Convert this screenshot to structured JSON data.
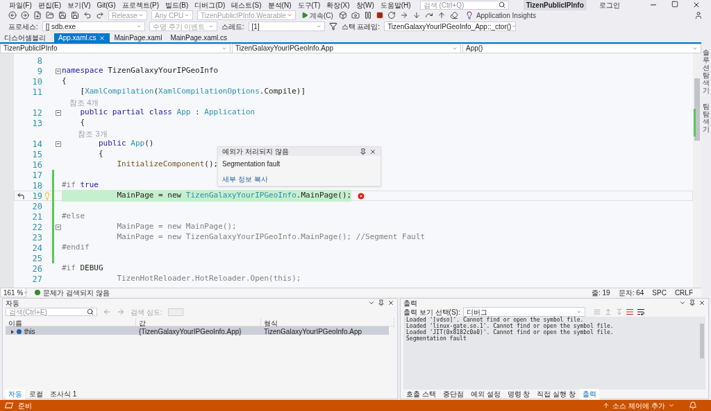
{
  "menu": {
    "items": [
      "파일(F)",
      "편집(E)",
      "보기(V)",
      "Git(G)",
      "프로젝트(P)",
      "빌드(B)",
      "디버그(D)",
      "테스트(S)",
      "분석(N)",
      "도구(T)",
      "확장(X)",
      "창(W)",
      "도움말(H)"
    ],
    "search_placeholder": "검색 (Ctrl+Q)",
    "solution_name": "TizenPublicIPInfo",
    "sign_in": "로그인"
  },
  "toolbar": {
    "configuration": "Release",
    "platform": "Any CPU",
    "startup": "TizenPublicIPInfo.Wearable",
    "continue": "계속(C)",
    "insights": "Application Insights"
  },
  "debug_bar": {
    "process_label": "프로세스:",
    "process": "[] sdb.exe",
    "lifecycle": "수명 주기 이벤트",
    "thread_label": "스레드:",
    "thread": "[1]",
    "stack_label": "스택 프레임:",
    "stack_frame": "TizenGalaxyYourIPGeoInfo_App::_ctor()"
  },
  "doc_tabs": [
    {
      "label": "디스어셈블리",
      "selected": false
    },
    {
      "label": "App.xaml.cs",
      "selected": true
    },
    {
      "label": "MainPage.xaml",
      "selected": false
    },
    {
      "label": "MainPage.xaml.cs",
      "selected": false
    }
  ],
  "nav_bar": {
    "project": "TizenPublicIPInfo",
    "type": "TizenGalaxyYourIPGeoInfo.App",
    "member": "App()"
  },
  "code_lines": [
    {
      "kind": "code",
      "number": "8",
      "fold": false,
      "changed": false,
      "current": false
    },
    {
      "kind": "code",
      "number": "9",
      "fold": true,
      "changed": false,
      "current": false,
      "tokens": [
        {
          "kind": "keyword",
          "text": "namespace"
        },
        {
          "kind": "plain",
          "text": " TizenGalaxyYourIPGeoInfo"
        }
      ]
    },
    {
      "kind": "code",
      "number": "10",
      "fold": false,
      "changed": false,
      "current": false,
      "tokens": [
        {
          "kind": "plain",
          "text": "{"
        }
      ]
    },
    {
      "kind": "code",
      "number": "11",
      "fold": false,
      "changed": false,
      "current": false,
      "tokens": [
        {
          "kind": "plain",
          "text": "    ["
        },
        {
          "kind": "type",
          "text": "XamlCompilation"
        },
        {
          "kind": "plain",
          "text": "("
        },
        {
          "kind": "type",
          "text": "XamlCompilationOptions"
        },
        {
          "kind": "plain",
          "text": ".Compile)]"
        }
      ]
    },
    {
      "kind": "lens",
      "text": "    참조 4개"
    },
    {
      "kind": "code",
      "number": "12",
      "fold": true,
      "changed": false,
      "current": false,
      "tokens": [
        {
          "kind": "keyword",
          "text": "    public partial class "
        },
        {
          "kind": "type",
          "text": "App"
        },
        {
          "kind": "plain",
          "text": " : "
        },
        {
          "kind": "type",
          "text": "Application"
        }
      ]
    },
    {
      "kind": "code",
      "number": "13",
      "fold": false,
      "changed": false,
      "current": false,
      "tokens": [
        {
          "kind": "plain",
          "text": "    {"
        }
      ]
    },
    {
      "kind": "lens",
      "text": "        참조 3개"
    },
    {
      "kind": "code",
      "number": "14",
      "fold": true,
      "changed": false,
      "current": false,
      "tokens": [
        {
          "kind": "keyword",
          "text": "        public "
        },
        {
          "kind": "type",
          "text": "App"
        },
        {
          "kind": "plain",
          "text": "()"
        }
      ]
    },
    {
      "kind": "code",
      "number": "15",
      "fold": false,
      "changed": false,
      "current": false,
      "tokens": [
        {
          "kind": "plain",
          "text": "        {"
        }
      ]
    },
    {
      "kind": "code",
      "number": "16",
      "fold": false,
      "changed": false,
      "current": false,
      "tokens": [
        {
          "kind": "method",
          "text": "            InitializeComponent"
        },
        {
          "kind": "plain",
          "text": "();"
        }
      ]
    },
    {
      "kind": "code",
      "number": "17",
      "fold": false,
      "changed": true,
      "current": false
    },
    {
      "kind": "code",
      "number": "18",
      "fold": false,
      "changed": true,
      "current": false,
      "tokens": [
        {
          "kind": "preprocessor",
          "text": "#if "
        },
        {
          "kind": "keyword",
          "text": "true"
        }
      ]
    },
    {
      "kind": "code",
      "number": "19",
      "fold": false,
      "changed": true,
      "current": true,
      "tokens": [
        {
          "kind": "plain",
          "text": "            MainPage = new "
        },
        {
          "kind": "type",
          "text": "TizenGalaxyYourIPGeoInfo"
        },
        {
          "kind": "plain",
          "text": ".MainPage();"
        }
      ]
    },
    {
      "kind": "code",
      "number": "20",
      "fold": false,
      "changed": true,
      "current": false
    },
    {
      "kind": "code",
      "number": "21",
      "fold": false,
      "changed": true,
      "current": false,
      "tokens": [
        {
          "kind": "preprocessor",
          "text": "#else"
        }
      ]
    },
    {
      "kind": "code",
      "number": "22",
      "fold": true,
      "changed": true,
      "current": false,
      "tokens": [
        {
          "kind": "inactive",
          "text": "            MainPage = new MainPage();"
        }
      ]
    },
    {
      "kind": "code",
      "number": "23",
      "fold": false,
      "changed": true,
      "current": false,
      "tokens": [
        {
          "kind": "inactive",
          "text": "            MainPage = new TizenGalaxyYourIPGeoInfo.MainPage(); //Segment Fault"
        }
      ]
    },
    {
      "kind": "code",
      "number": "24",
      "fold": false,
      "changed": true,
      "current": false,
      "tokens": [
        {
          "kind": "preprocessor",
          "text": "#endif"
        }
      ]
    },
    {
      "kind": "code",
      "number": "25",
      "fold": false,
      "changed": true,
      "current": false
    },
    {
      "kind": "code",
      "number": "26",
      "fold": false,
      "changed": false,
      "current": false,
      "tokens": [
        {
          "kind": "preprocessor",
          "text": "#if "
        },
        {
          "kind": "plain",
          "text": "DEBUG"
        }
      ]
    },
    {
      "kind": "code",
      "number": "27",
      "fold": false,
      "changed": false,
      "current": false,
      "tokens": [
        {
          "kind": "inactive",
          "text": "            TizenHotReloader.HotReloader.Open(this);"
        }
      ]
    }
  ],
  "exception_popup": {
    "title": "예외가 처리되지 않음",
    "message": "Segmentation fault",
    "link": "세부 정보 복사"
  },
  "editor_status": {
    "zoom": "161 %",
    "issues": "문제가 검색되지 않음",
    "line": "줄: 19",
    "column": "문자: 64",
    "spacing": "SPC",
    "line_ending": "CRLF"
  },
  "side_tabs": [
    "솔루션 탐색기",
    "팀 탐색기"
  ],
  "autos": {
    "title": "자동",
    "search_placeholder": "검색(Ctrl+E)",
    "depth_label": "검색 심도:",
    "columns": [
      "이름",
      "값",
      "형식"
    ],
    "rows": [
      {
        "name": "this",
        "value": "{TizenGalaxyYourIPGeoInfo.App}",
        "type": "TizenGalaxyYourIPGeoInfo.App",
        "selected": true
      }
    ],
    "tabs": [
      {
        "label": "자동",
        "selected": true
      },
      {
        "label": "로컬",
        "selected": false
      },
      {
        "label": "조사식 1",
        "selected": false
      }
    ]
  },
  "output": {
    "title": "출력",
    "source_label": "출력 보기 선택(S):",
    "source": "디버그",
    "lines": [
      "Loaded '[vdso]'. Cannot find or open the symbol file.",
      "Loaded 'linux-gate.so.1'. Cannot find or open the symbol file.",
      "Loaded 'JIT(0x8182c0a0)'. Cannot find or open the symbol file.",
      "Segmentation fault"
    ],
    "tabs": [
      {
        "label": "호출 스택",
        "selected": false
      },
      {
        "label": "중단점",
        "selected": false
      },
      {
        "label": "예외 설정",
        "selected": false
      },
      {
        "label": "명령 창",
        "selected": false
      },
      {
        "label": "직접 실행 창",
        "selected": false
      },
      {
        "label": "출력",
        "selected": true
      }
    ]
  },
  "status_bar": {
    "message": "준비",
    "source_control": "소스 제어에 추가"
  }
}
